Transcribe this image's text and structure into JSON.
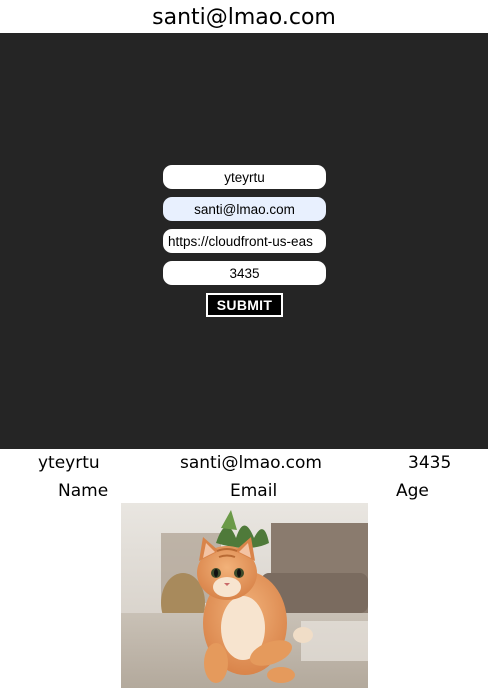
{
  "header": {
    "title": "santi@lmao.com"
  },
  "form": {
    "name_value": "yteyrtu",
    "email_value": "santi@lmao.com",
    "url_value": "https://cloudfront-us-eas",
    "age_value": "3435",
    "submit_label": "SUBMIT"
  },
  "results": {
    "name_value": "yteyrtu",
    "email_value": "santi@lmao.com",
    "age_value": "3435",
    "name_label": "Name",
    "email_label": "Email",
    "age_label": "Age"
  },
  "image": {
    "subject": "cat-photo"
  }
}
